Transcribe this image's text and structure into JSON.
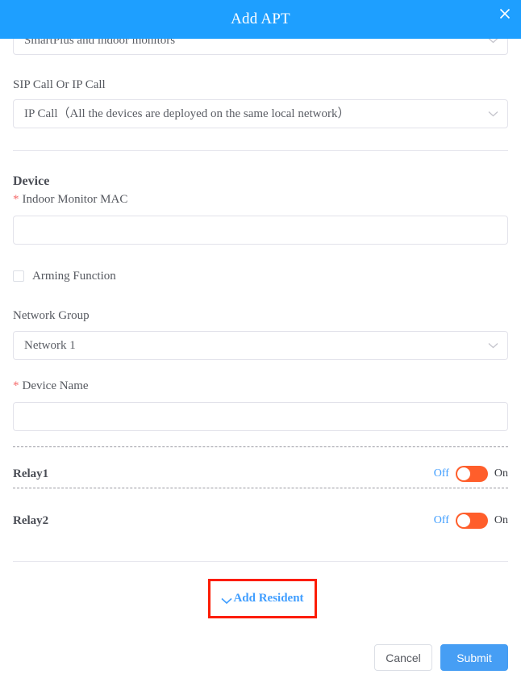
{
  "header": {
    "title": "Add APT",
    "close_icon": "close-icon",
    "background_color": "#1e9fff"
  },
  "form": {
    "device_type_select": {
      "value": "SmartPlus and indoor monitors",
      "chevron_icon": "chevron-down-icon"
    },
    "call_type": {
      "label": "SIP Call Or IP Call",
      "value": "IP Call（All the devices are deployed on the same local network）",
      "chevron_icon": "chevron-down-icon"
    },
    "device_section": {
      "title": "Device",
      "indoor_monitor_mac": {
        "required_marker": "*",
        "label": "Indoor Monitor MAC",
        "value": "",
        "placeholder": ""
      },
      "arming_function": {
        "label": "Arming Function",
        "checked": false
      },
      "network_group": {
        "label": "Network Group",
        "value": "Network 1",
        "chevron_icon": "chevron-down-icon"
      },
      "device_name": {
        "required_marker": "*",
        "label": "Device Name",
        "value": "",
        "placeholder": ""
      }
    },
    "relays": [
      {
        "name": "Relay1",
        "off_label": "Off",
        "on_label": "On",
        "state": "Off"
      },
      {
        "name": "Relay2",
        "off_label": "Off",
        "on_label": "On",
        "state": "Off"
      }
    ],
    "add_resident": {
      "label": "Add Resident",
      "chevron_icon": "chevron-down-icon",
      "highlight_color": "#fc1d05",
      "link_color": "#409eff"
    }
  },
  "footer": {
    "cancel_label": "Cancel",
    "submit_label": "Submit",
    "submit_color": "#469ef4"
  }
}
